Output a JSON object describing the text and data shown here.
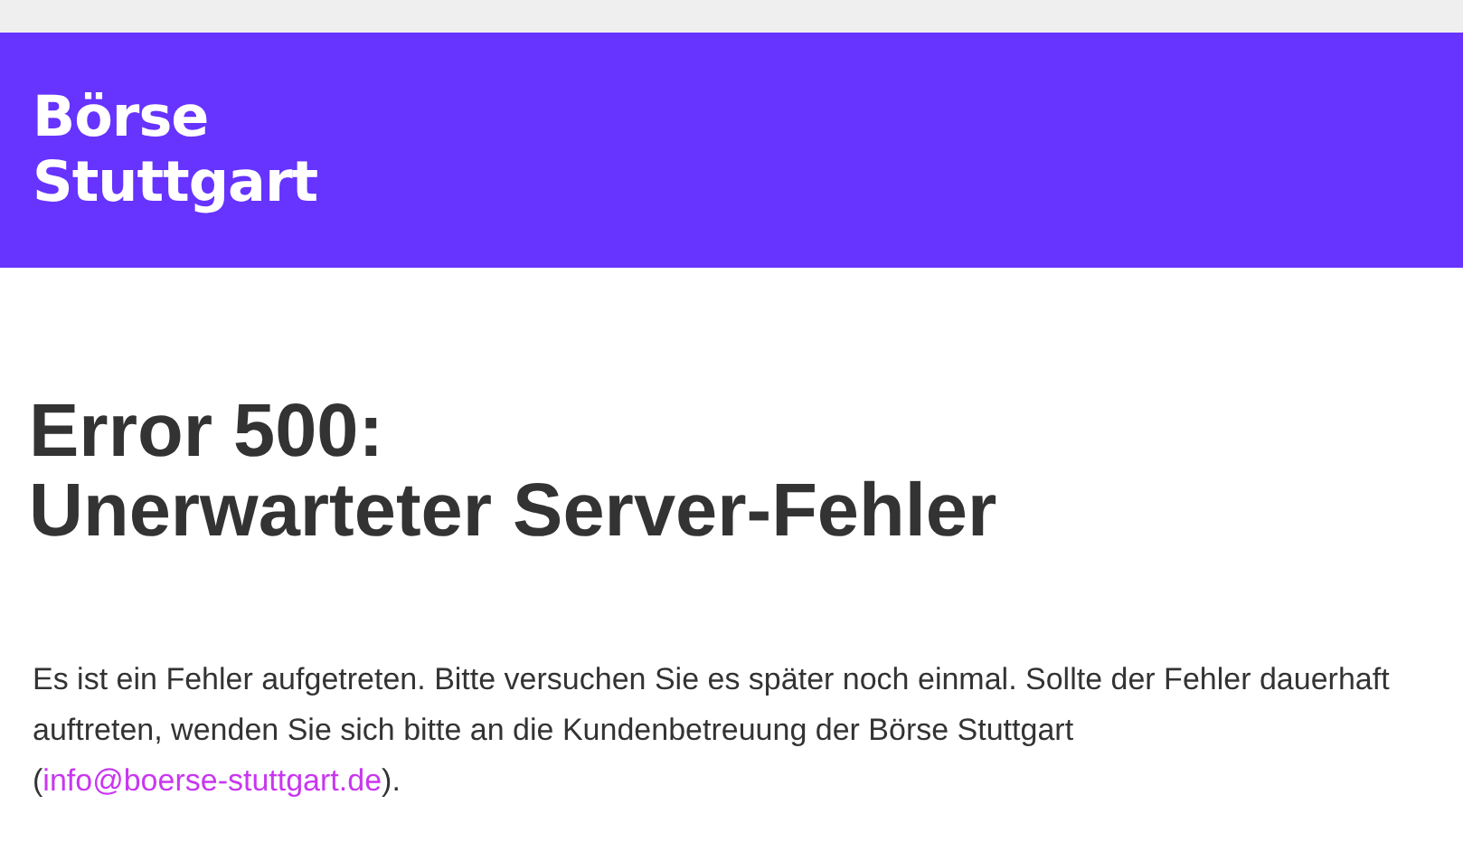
{
  "header": {
    "logo_lines": [
      "Börse",
      "Stuttgart"
    ]
  },
  "heading_lines": [
    "Error 500:",
    "Unerwarteter Server-Fehler"
  ],
  "message": {
    "text": "Es ist ein Fehler aufgetreten. Bitte versuchen Sie es später noch einmal. Sollte der Fehler dauerhaft auftreten, wenden Sie sich bitte an die Kundenbetreuung der Börse Stuttgart (",
    "link": "info@boerse-stuttgart.de",
    "after": ")."
  }
}
